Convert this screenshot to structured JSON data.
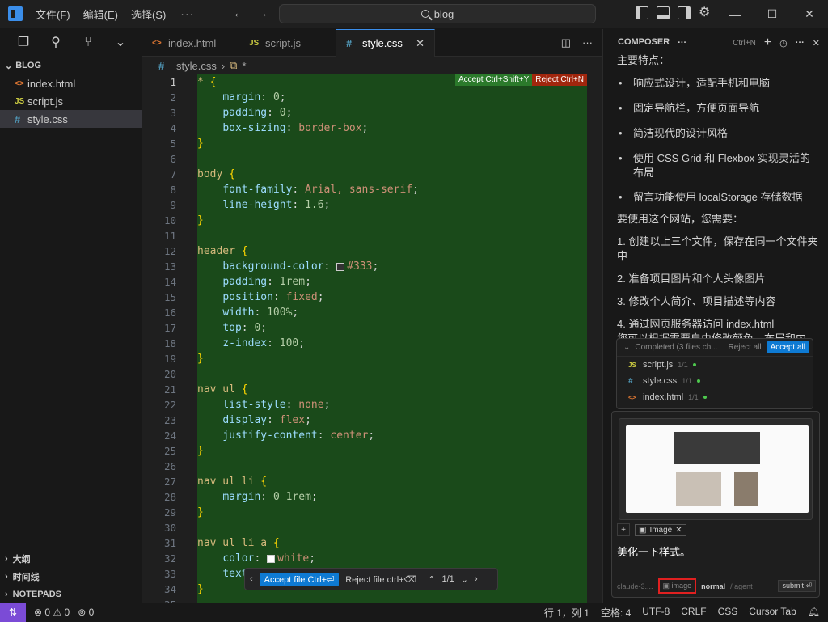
{
  "titlebar": {
    "menus": [
      "文件(F)",
      "编辑(E)",
      "选择(S)"
    ],
    "more": "···",
    "search": "blog"
  },
  "sidebar": {
    "folder": "BLOG",
    "files": [
      {
        "name": "index.html",
        "type": "html"
      },
      {
        "name": "script.js",
        "type": "js"
      },
      {
        "name": "style.css",
        "type": "css",
        "active": true
      }
    ],
    "sections": [
      "大纲",
      "时间线",
      "NOTEPADS"
    ]
  },
  "editor": {
    "tabs": [
      {
        "label": "index.html",
        "type": "html"
      },
      {
        "label": "script.js",
        "type": "js"
      },
      {
        "label": "style.css",
        "type": "css",
        "active": true
      }
    ],
    "breadcrumb": {
      "file": "style.css",
      "symbol": "*"
    },
    "accept_inline": "Accept Ctrl+Shift+Y",
    "reject_inline": "Reject Ctrl+N",
    "review": {
      "accept_file": "Accept file Ctrl+⏎",
      "reject_file": "Reject file ctrl+⌫",
      "counter": "1/1"
    }
  },
  "composer": {
    "title": "COMPOSER",
    "shortcut": "Ctrl+N",
    "intro": "主要特点：",
    "features": [
      "响应式设计，适配手机和电脑",
      "固定导航栏，方便页面导航",
      "简洁现代的设计风格",
      "使用 CSS Grid 和 Flexbox 实现灵活的布局",
      "留言功能使用 localStorage 存储数据"
    ],
    "usage_title": "要使用这个网站，您需要：",
    "steps": [
      "1. 创建以上三个文件，保存在同一个文件夹中",
      "2. 准备项目图片和个人头像图片",
      "3. 修改个人简介、项目描述等内容",
      "4. 通过网页服务器访问 index.html"
    ],
    "trailing": "您可以根据需要自由修改颜色、布局和内",
    "completed": {
      "label": "Completed (3 files ch...",
      "reject_all": "Reject all",
      "accept_all": "Accept all",
      "files": [
        {
          "name": "script.js",
          "type": "js",
          "count": "1/1"
        },
        {
          "name": "style.css",
          "type": "css",
          "count": "1/1"
        },
        {
          "name": "index.html",
          "type": "html",
          "count": "1/1"
        }
      ]
    },
    "chip": "Image",
    "prompt": "美化一下样式。",
    "model": "claude-3....",
    "image_btn": "image",
    "mode_normal": "normal",
    "mode_agent": "/ agent",
    "submit": "submit ⏎"
  },
  "statusbar": {
    "errors": "0",
    "warnings": "0",
    "ports": "0",
    "position": "行 1，列 1",
    "spaces": "空格: 4",
    "encoding": "UTF-8",
    "eol": "CRLF",
    "lang": "CSS",
    "cursor_tab": "Cursor Tab"
  }
}
